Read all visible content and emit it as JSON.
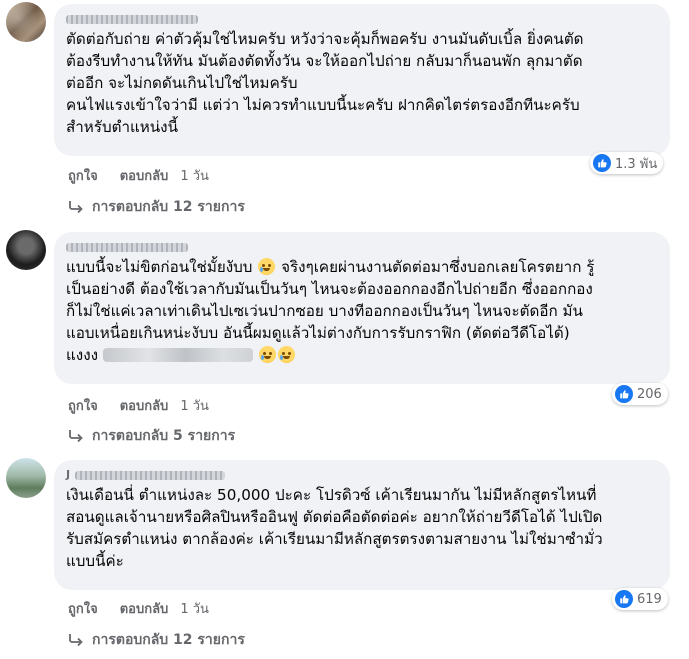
{
  "comments": [
    {
      "author": "",
      "text": "ตัดต่อกับถ่าย ค่าตัวคุ้มใช่ไหมครับ หวังว่าจะคุ้มก็พอครับ งานมันดับเบิ้ล ยิ่งคนตัด\nต้องรีบทำงานให้ทัน มันต้องตัดทั้งวัน จะให้ออกไปถ่าย กลับมาก็นอนพัก ลุกมาตัด\nต่ออีก จะไม่กดดันเกินไปใช่ไหมครับ\nคนไฟแรงเข้าใจว่ามี แต่ว่า ไม่ควรทำแบบนี้นะครับ ฝากคิดไตร่ตรองอีกทีนะครับ\nสำหรับตำแหน่งนี้",
      "reaction_count": "1.3 พัน",
      "like_label": "ถูกใจ",
      "reply_label": "ตอบกลับ",
      "time": "1 วัน",
      "replies": "การตอบกลับ 12 รายการ"
    },
    {
      "author": "",
      "text_lines": [
        "แบบนี้จะไม่ขิตก่อนใช่มั้ยงับบ",
        " จริงๆเคยผ่านงานตัดต่อมาซึ่งบอกเลยโครตยาก รู้",
        "เป็นอย่างดี ต้องใช้เวลากับมันเป็นวันๆ ไหนจะต้องออกกองอีกไปถ่ายอีก ซึ่งออกกอง",
        "ก็ไม่ใช่แค่เวลาเท่าเดินไปเซเว่นปากซอย บางทีออกกองเป็นวันๆ ไหนจะตัดอีก มัน",
        "แอบเหนื่อยเกินหน่ะงับบ อันนี้ผมดูแล้วไม่ต่างกับการรับกราฟิก (ตัดต่อวีดีโอได้)",
        "แงงง"
      ],
      "reaction_count": "206",
      "like_label": "ถูกใจ",
      "reply_label": "ตอบกลับ",
      "time": "1 วัน",
      "replies": "การตอบกลับ 5 รายการ"
    },
    {
      "author": "J",
      "text": "เงินเดือนนี่ ตำแหน่งละ 50,000 ปะคะ โปรดิวซ์ เค้าเรียนมากัน ไม่มีหลักสูตรไหนที่\nสอนดูแลเจ้านายหรือศิลปินหรืออินฟู ตัดต่อคือตัดต่อค่ะ อยากให้ถ่ายวีดีโอได้ ไปเปิด\nรับสมัครตำแหน่ง ตากล้องค่ะ เค้าเรียนมามีหลักสูตรตรงตามสายงาน ไม่ใช่มาซำมั่ว\nแบบนี้ค่ะ",
      "reaction_count": "619",
      "like_label": "ถูกใจ",
      "reply_label": "ตอบกลับ",
      "time": "1 วัน",
      "replies": "การตอบกลับ 12 รายการ"
    }
  ],
  "colors": {
    "bubble": "#f0f2f5",
    "meta_text": "#65676b",
    "like_blue": "#1877f2"
  },
  "icons": {
    "like": "thumbs-up-icon",
    "reply_arrow": "reply-arrow-icon",
    "emoji": "crying-emoji-icon"
  }
}
